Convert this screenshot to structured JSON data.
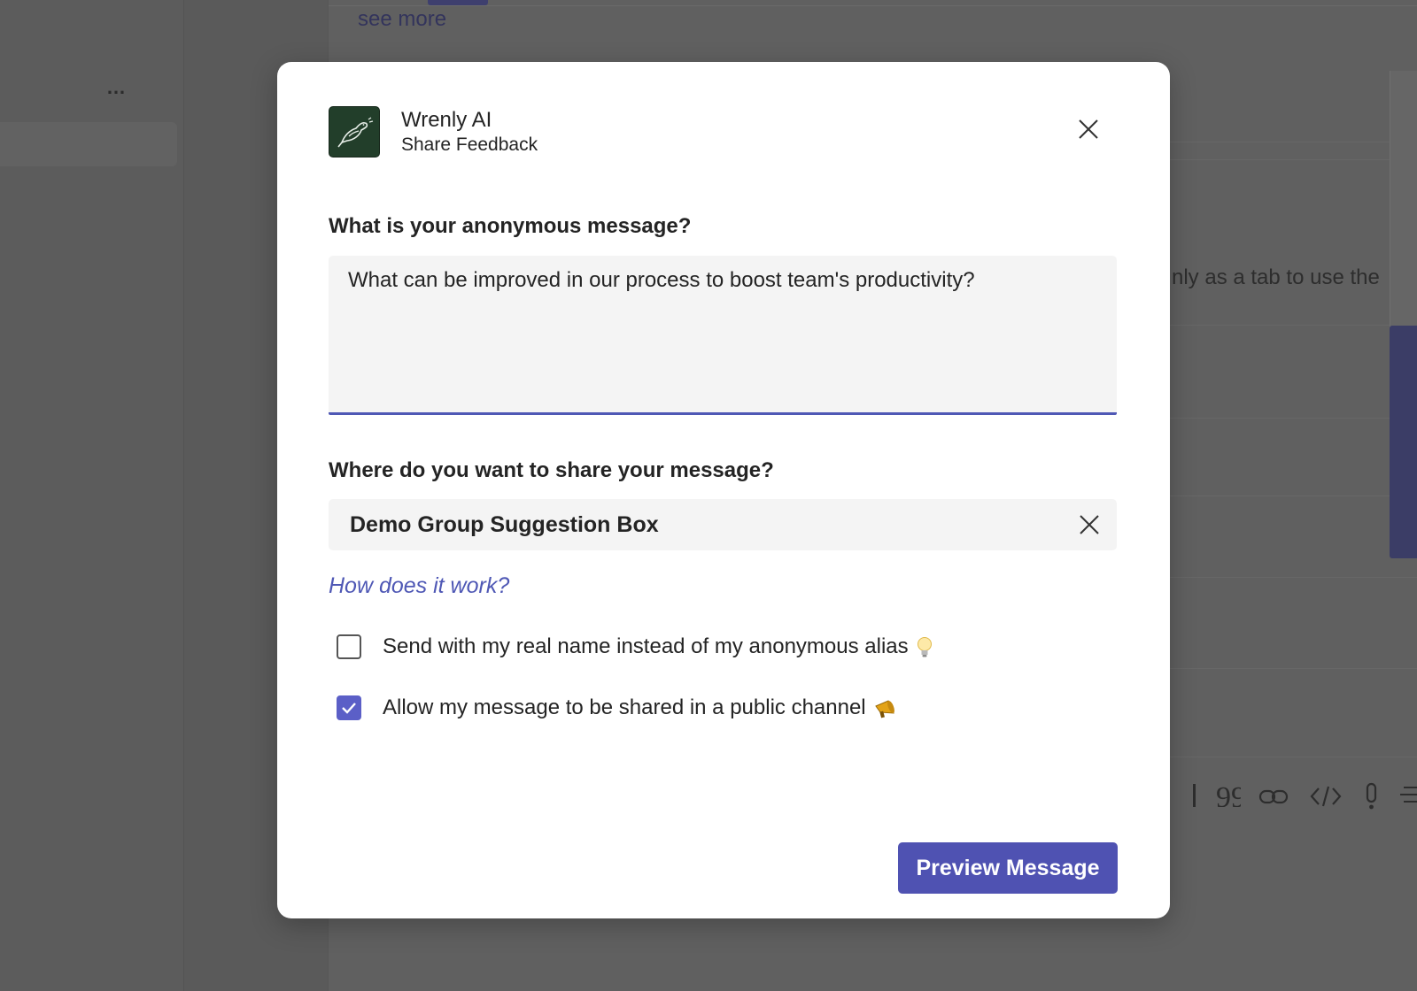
{
  "background": {
    "see_more": "see more",
    "ghost_text": "nly as a tab to use the",
    "more_icon": "…",
    "format_icons": [
      "quote-icon",
      "link-icon",
      "code-icon",
      "important-icon",
      "more-format-icon"
    ]
  },
  "dialog": {
    "app_name": "Wrenly AI",
    "app_subtitle": "Share Feedback",
    "message_label": "What is your anonymous message?",
    "message_value": "What can be improved in our process to boost team's productivity?",
    "share_label": "Where do you want to share your message?",
    "share_value": "Demo Group Suggestion Box",
    "how_link": "How does it work?",
    "checkboxes": [
      {
        "label": "Send with my real name instead of my anonymous alias",
        "checked": false,
        "emoji": "lightbulb-icon"
      },
      {
        "label": "Allow my message to be shared in a public channel",
        "checked": true,
        "emoji": "megaphone-icon"
      }
    ],
    "preview_button": "Preview Message"
  },
  "colors": {
    "accent": "#4f52b2",
    "link": "#4f58b5",
    "logo_bg": "#223e2a",
    "overlay": "#5f5f5f"
  }
}
